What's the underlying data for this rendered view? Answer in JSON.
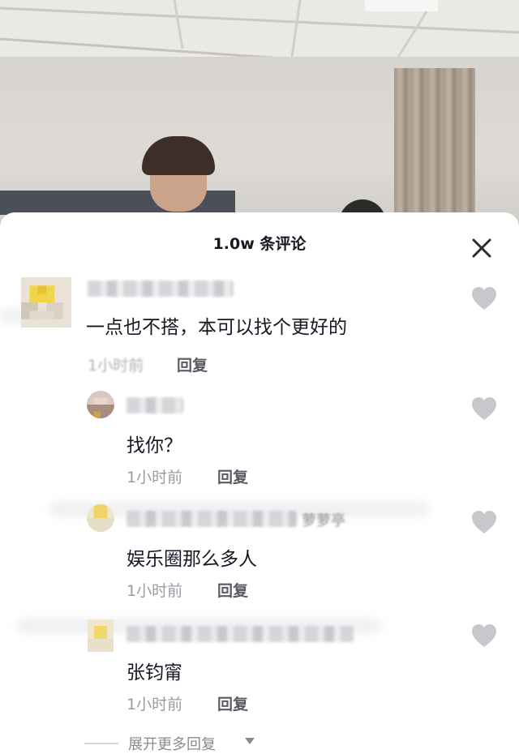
{
  "sheet": {
    "comment_count": "1.0w 条评论"
  },
  "comments": [
    {
      "text": "一点也不搭，本可以找个更好的",
      "time": "1小时前",
      "reply_label": "回复"
    },
    {
      "text": "找你？",
      "time": "1小时前",
      "reply_label": "回复"
    },
    {
      "username_tail": "萝萝亭",
      "text": "娱乐圈那么多人",
      "time": "1小时前",
      "reply_label": "回复"
    },
    {
      "text": "张钧甯",
      "time": "1小时前",
      "reply_label": "回复"
    }
  ],
  "expand": {
    "label": "展开更多回复"
  },
  "colors": {
    "text_primary": "#161823",
    "text_secondary": "#9b9ca2",
    "like_icon": "#c7c8cc"
  }
}
